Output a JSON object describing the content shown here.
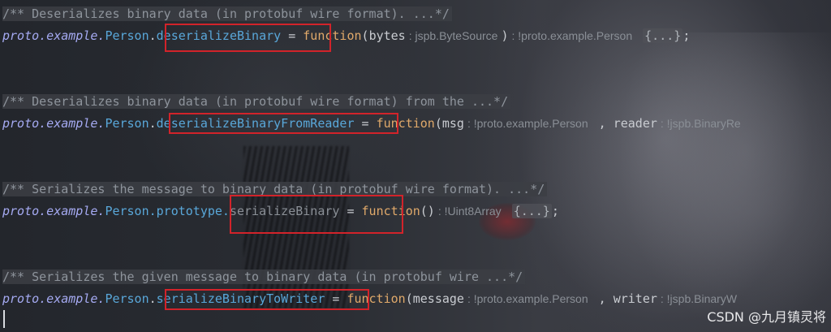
{
  "blocks": [
    {
      "comment": "/** Deserializes binary data (in protobuf wire format). ...*/",
      "ns": "proto.example.",
      "cls": "Person",
      "method": "deserializeBinary",
      "assign": " = ",
      "keyword": "function",
      "open": "(",
      "param1": "bytes",
      "hint1": ": jspb.ByteSource",
      "close": ")",
      "ret": ": !proto.example.Person",
      "fold": "{...}",
      "semi": ";"
    },
    {
      "comment": "/** Deserializes binary data (in protobuf wire format) from the ...*/",
      "ns": "proto.example.",
      "cls": "Person",
      "dot": ".",
      "method": "deserializeBinaryFromReader",
      "assign": " = ",
      "keyword": "function",
      "open": "(",
      "param1": "msg",
      "hint1": ": !proto.example.Person",
      "comma": " , ",
      "param2": "reader",
      "hint2": ": !jspb.BinaryRe"
    },
    {
      "comment": "/** Serializes the message to binary data (in protobuf wire format). ...*/",
      "ns": "proto.example.",
      "cls": "Person",
      "proto": ".prototype.",
      "method": "serializeBinary",
      "assign": " = ",
      "keyword": "function",
      "parens": "()",
      "ret": ": !Uint8Array",
      "fold": "{...}",
      "semi": ";"
    },
    {
      "comment": "/** Serializes the given message to binary data (in protobuf wire ...*/",
      "ns": "proto.example.",
      "cls": "Person",
      "dot": ".",
      "method": "serializeBinaryToWriter",
      "assign": " = ",
      "keyword": "function",
      "open": "(",
      "param1": "message",
      "hint1": ": !proto.example.Person",
      "comma": " , ",
      "param2": "writer",
      "hint2": ": !jspb.BinaryW"
    }
  ],
  "watermark": "CSDN @九月镇灵将",
  "colors": {
    "highlight_box": "#d2232a",
    "keyword": "#e0a96a",
    "namespace": "#a5aaf2",
    "identifier": "#59a7d9",
    "comment": "#8e949c"
  }
}
